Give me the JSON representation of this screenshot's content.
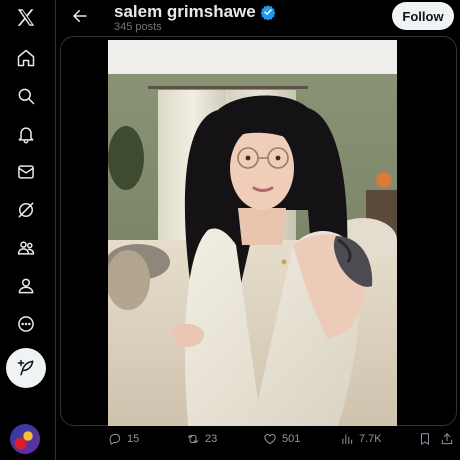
{
  "header": {
    "name": "salem grimshawe",
    "posts_count": "345 posts",
    "follow_label": "Follow"
  },
  "sidebar": {
    "items": [
      {
        "icon": "x-logo-icon"
      },
      {
        "icon": "home-icon"
      },
      {
        "icon": "search-icon"
      },
      {
        "icon": "bell-icon"
      },
      {
        "icon": "mail-icon"
      },
      {
        "icon": "grok-icon"
      },
      {
        "icon": "communities-icon"
      },
      {
        "icon": "profile-icon"
      },
      {
        "icon": "more-icon"
      }
    ],
    "post_button_icon": "feather-plus-icon"
  },
  "actions": {
    "replies": "15",
    "reposts": "23",
    "likes": "501",
    "views": "7.7K"
  },
  "colors": {
    "background": "#000000",
    "border": "#2f3336",
    "text": "#e7e9ea",
    "muted": "#71767b",
    "verified": "#1d9bf0"
  }
}
